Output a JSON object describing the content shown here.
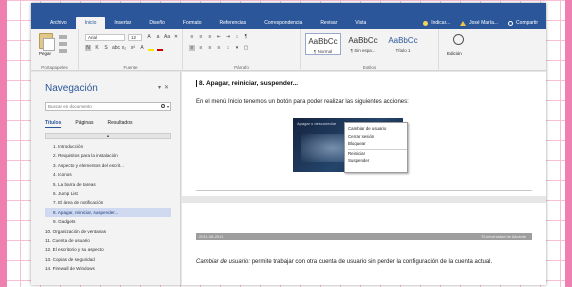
{
  "ribbon_tabs": [
    "Archivo",
    "Inicio",
    "Insertar",
    "Diseño",
    "Formato",
    "Referencias",
    "Correspondencia",
    "Revisar",
    "Vista"
  ],
  "active_tab": "Inicio",
  "tell_me": "Indicar...",
  "user_name": "José María...",
  "share_label": "Compartir",
  "ribbon": {
    "paste_label": "Pegar",
    "font_name": "Arial",
    "font_size": "12",
    "style_samples": [
      {
        "sample": "AaBbCc",
        "name": "¶ Normal"
      },
      {
        "sample": "AaBbCc",
        "name": "¶ Sin espa..."
      },
      {
        "sample": "AaBbCc",
        "name": "Título 1"
      }
    ],
    "edit_label": "Edición",
    "group_labels": {
      "clipboard": "Portapapeles",
      "font": "Fuente",
      "paragraph": "Párrafo",
      "styles": "Estilos"
    }
  },
  "nav": {
    "title": "Navegación",
    "search_placeholder": "Buscar en documento",
    "tabs": [
      "Títulos",
      "Páginas",
      "Resultados"
    ],
    "items": [
      {
        "label": "1. Introducción",
        "level": 2
      },
      {
        "label": "2. Requisitos para la instalación",
        "level": 2
      },
      {
        "label": "3. Aspecto y elementos del escrit...",
        "level": 2
      },
      {
        "label": "4. Iconos",
        "level": 2
      },
      {
        "label": "5. La barra de tareas",
        "level": 2
      },
      {
        "label": "6. Jump List",
        "level": 2
      },
      {
        "label": "7. El área de notificación",
        "level": 2
      },
      {
        "label": "8. Apagar, reiniciar, suspender...",
        "level": 2,
        "selected": true
      },
      {
        "label": "9. Gadgets",
        "level": 2
      },
      {
        "label": "10. Organización de ventanas",
        "level": 1
      },
      {
        "label": "11. Cuenta de usuario",
        "level": 1
      },
      {
        "label": "12. El escritorio y su aspecto",
        "level": 1
      },
      {
        "label": "13. Copias de seguridad",
        "level": 1
      },
      {
        "label": "14. Firewall de Windows",
        "level": 1
      }
    ]
  },
  "doc": {
    "heading": "8. Apagar, reiniciar, suspender...",
    "paragraph1": "En el menú Inicio tenemos un botón para poder realizar las siguientes acciones:",
    "screenshot_title": "Apagar o desconectar",
    "context_menu": [
      "Cambiar de usuario",
      "Cerrar sesión",
      "Bloquear",
      "Reiniciar",
      "Suspender"
    ],
    "band_left": "2011-08-2011",
    "band_right": "©Universidad de Alicante",
    "paragraph2_italic": "Cambiar de usuario:",
    "paragraph2_rest": " permite trabajar con otra cuenta de usuario sin perder la configuración de la cuenta actual."
  }
}
